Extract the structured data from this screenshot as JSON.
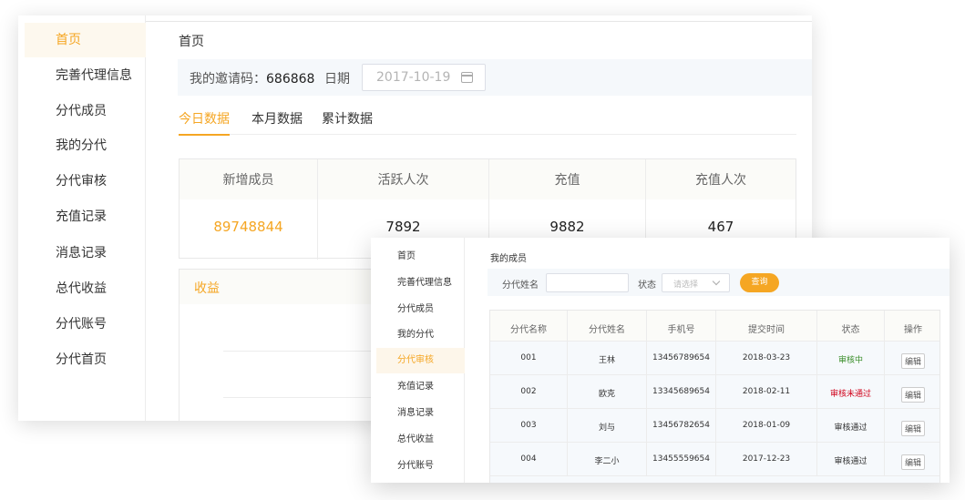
{
  "back_window": {
    "sidebar": [
      {
        "label": "首页",
        "active": true
      },
      {
        "label": "完善代理信息"
      },
      {
        "label": "分代成员"
      },
      {
        "label": "我的分代"
      },
      {
        "label": "分代审核"
      },
      {
        "label": "充值记录"
      },
      {
        "label": "消息记录"
      },
      {
        "label": "总代收益"
      },
      {
        "label": "分代账号"
      },
      {
        "label": "分代首页"
      }
    ],
    "title": "首页",
    "invite_label": "我的邀请码：",
    "invite_code": "686868",
    "date_label": "日期",
    "date_value": "2017-10-19",
    "tabs": [
      {
        "label": "今日数据",
        "active": true
      },
      {
        "label": "本月数据"
      },
      {
        "label": "累计数据"
      }
    ],
    "stats": [
      {
        "label": "新增成员",
        "value": "89748844",
        "highlight": true
      },
      {
        "label": "活跃人次",
        "value": "7892"
      },
      {
        "label": "充值",
        "value": "9882"
      },
      {
        "label": "充值人次",
        "value": "467"
      }
    ],
    "income_title": "收益"
  },
  "front_window": {
    "sidebar": [
      {
        "label": "首页"
      },
      {
        "label": "完善代理信息"
      },
      {
        "label": "分代成员"
      },
      {
        "label": "我的分代"
      },
      {
        "label": "分代审核",
        "active": true
      },
      {
        "label": "充值记录"
      },
      {
        "label": "消息记录"
      },
      {
        "label": "总代收益"
      },
      {
        "label": "分代账号"
      }
    ],
    "title": "我的成员",
    "filter": {
      "name_label": "分代姓名",
      "name_value": "",
      "status_label": "状态",
      "status_placeholder": "请选择",
      "search_button": "查询"
    },
    "table": {
      "headers": [
        "分代名称",
        "分代姓名",
        "手机号",
        "提交时间",
        "状态",
        "操作"
      ],
      "rows": [
        {
          "code": "001",
          "name": "王林",
          "phone": "13456789654",
          "date": "2018-03-23",
          "status": "审核中",
          "status_color": "#3a8e2a",
          "action": "编辑"
        },
        {
          "code": "002",
          "name": "欧克",
          "phone": "13345689654",
          "date": "2018-02-11",
          "status": "审核未通过",
          "status_color": "#d0021b",
          "action": "编辑"
        },
        {
          "code": "003",
          "name": "刘与",
          "phone": "13456782654",
          "date": "2018-01-09",
          "status": "审核通过",
          "status_color": "#333333",
          "action": "编辑"
        },
        {
          "code": "004",
          "name": "李二小",
          "phone": "13455559654",
          "date": "2017-12-23",
          "status": "审核通过",
          "status_color": "#333333",
          "action": "编辑"
        }
      ]
    }
  },
  "colors": {
    "accent": "#f5a623",
    "green": "#3a8e2a",
    "red": "#d0021b"
  }
}
